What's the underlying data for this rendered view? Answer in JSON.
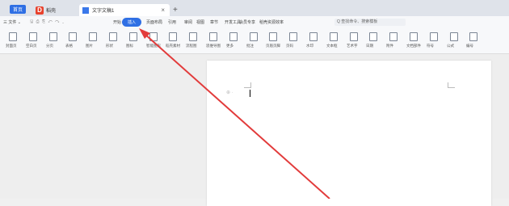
{
  "tabs": {
    "home_label": "首页",
    "wps_label": "稻壳",
    "doc_label": "文字文稿1",
    "close_glyph": "×",
    "new_glyph": "+"
  },
  "menu": {
    "file": "三 文件 ⌄",
    "quick_access": "🖫 ⎙ ⎘ ↶ ↷ ⌄",
    "start": "开始",
    "insert": "插入",
    "draw": "页面布局",
    "layout": "引用",
    "ref": "审阅",
    "review": "视图",
    "view": "章节",
    "chapter": "开发工具",
    "dev": "会员专享",
    "member": "稻壳资源",
    "features": "效率",
    "help": "",
    "search_placeholder": "Q 查找命令、搜索模板"
  },
  "ribbon": {
    "items": [
      {
        "label": "封面页",
        "icon": "cover-page-icon"
      },
      {
        "label": "空白页",
        "icon": "blank-page-icon"
      },
      {
        "label": "分页",
        "icon": "page-break-icon"
      },
      {
        "label": "表格",
        "icon": "table-icon"
      },
      {
        "label": "图片",
        "icon": "picture-icon"
      },
      {
        "label": "形状",
        "icon": "shape-icon"
      },
      {
        "label": "图标",
        "icon": "icons-icon"
      },
      {
        "label": "智能图形",
        "icon": "smartart-icon"
      },
      {
        "label": "稻壳素材",
        "icon": "material-icon"
      },
      {
        "label": "流程图",
        "icon": "flowchart-icon"
      },
      {
        "label": "思维导图",
        "icon": "mindmap-icon"
      },
      {
        "label": "更多",
        "icon": "more-icon"
      },
      {
        "label": "批注",
        "icon": "comment-icon"
      },
      {
        "label": "页眉页脚",
        "icon": "header-footer-icon"
      },
      {
        "label": "页码",
        "icon": "page-number-icon"
      },
      {
        "label": "水印",
        "icon": "watermark-icon"
      },
      {
        "label": "文本框",
        "icon": "textbox-icon"
      },
      {
        "label": "艺术字",
        "icon": "wordart-icon"
      },
      {
        "label": "日期",
        "icon": "date-icon"
      },
      {
        "label": "附件",
        "icon": "attachment-icon"
      },
      {
        "label": "文档部件",
        "icon": "doc-parts-icon"
      },
      {
        "label": "符号",
        "icon": "symbol-icon"
      },
      {
        "label": "公式",
        "icon": "formula-icon"
      },
      {
        "label": "编号",
        "icon": "numbering-icon"
      }
    ]
  },
  "colors": {
    "accent": "#2f6fe4",
    "arrow": "#e23b3b"
  }
}
